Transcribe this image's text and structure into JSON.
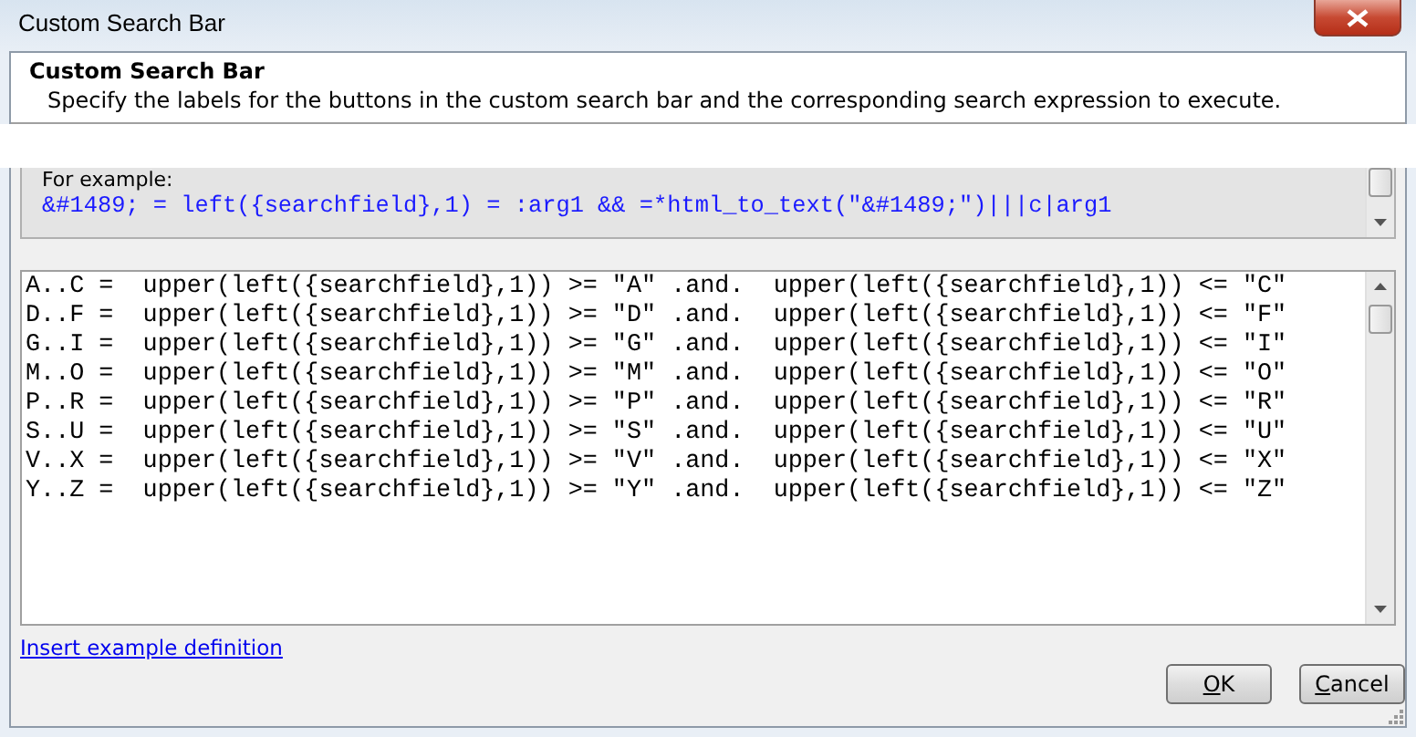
{
  "window": {
    "title": "Custom Search Bar"
  },
  "header": {
    "title": "Custom Search Bar",
    "description": "Specify the labels for the buttons in the custom search bar and the corresponding search expression to execute."
  },
  "example": {
    "label": "For example:",
    "code": "&#1489; = left({searchfield},1) = :arg1 && =*html_to_text(\"&#1489;\")|||c|arg1"
  },
  "editor": {
    "lines": [
      "A..C =  upper(left({searchfield},1)) >= \"A\" .and.  upper(left({searchfield},1)) <= \"C\"",
      "D..F =  upper(left({searchfield},1)) >= \"D\" .and.  upper(left({searchfield},1)) <= \"F\"",
      "G..I =  upper(left({searchfield},1)) >= \"G\" .and.  upper(left({searchfield},1)) <= \"I\"",
      "M..O =  upper(left({searchfield},1)) >= \"M\" .and.  upper(left({searchfield},1)) <= \"O\"",
      "P..R =  upper(left({searchfield},1)) >= \"P\" .and.  upper(left({searchfield},1)) <= \"R\"",
      "S..U =  upper(left({searchfield},1)) >= \"S\" .and.  upper(left({searchfield},1)) <= \"U\"",
      "V..X =  upper(left({searchfield},1)) >= \"V\" .and.  upper(left({searchfield},1)) <= \"X\"",
      "Y..Z =  upper(left({searchfield},1)) >= \"Y\" .and.  upper(left({searchfield},1)) <= \"Z\""
    ]
  },
  "link": "Insert example definition",
  "buttons": [
    {
      "label": "OK"
    },
    {
      "label": "Cancel"
    }
  ]
}
